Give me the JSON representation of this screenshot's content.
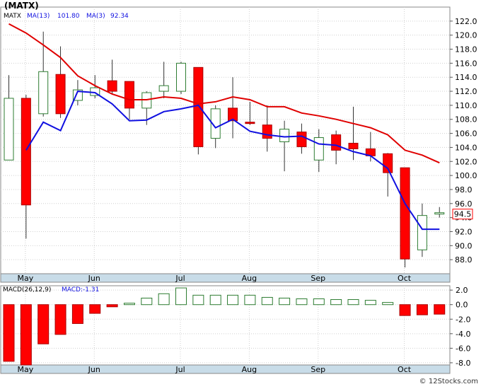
{
  "title": "(MATX)",
  "watermark": "© 12Stocks.com",
  "colors": {
    "up": "#2e7d32",
    "down": "#ff0000",
    "ma13": "#e00000",
    "ma3": "#1010e0",
    "axis_band": "#c8dce8",
    "grid": "#d0d0d0",
    "price_tag_border": "#ff0000"
  },
  "chart_data": [
    {
      "type": "candlestick",
      "legend": {
        "symbol": "MATX",
        "ma13_label": "MA(13)",
        "ma13_value": "101.80",
        "ma3_label": "MA(3)",
        "ma3_value": "92.34"
      },
      "ylim": [
        86,
        124
      ],
      "yticks": [
        88,
        90,
        92,
        94,
        96,
        98,
        100,
        102,
        104,
        106,
        108,
        110,
        112,
        114,
        116,
        118,
        120,
        122
      ],
      "ytick_labels": [
        "88.0",
        "90.0",
        "92.0",
        "94.0",
        "96.0",
        "98.0",
        "100.0",
        "102.0",
        "104.0",
        "106.0",
        "108.0",
        "110.0",
        "112.0",
        "114.0",
        "116.0",
        "118.0",
        "120.0",
        "122.0"
      ],
      "x_labels": [
        {
          "index": 1,
          "label": "May"
        },
        {
          "index": 5,
          "label": "Jun"
        },
        {
          "index": 10,
          "label": "Jul"
        },
        {
          "index": 14,
          "label": "Aug"
        },
        {
          "index": 18,
          "label": "Sep"
        },
        {
          "index": 23,
          "label": "Oct"
        }
      ],
      "last_price_tag": "94.5",
      "last_price": 94.5,
      "candles": [
        {
          "open": 102.2,
          "high": 114.3,
          "low": 102.2,
          "close": 111.0
        },
        {
          "open": 111.0,
          "high": 111.5,
          "low": 91.0,
          "close": 95.8
        },
        {
          "open": 108.8,
          "high": 120.5,
          "low": 108.4,
          "close": 114.8
        },
        {
          "open": 114.4,
          "high": 118.4,
          "low": 108.2,
          "close": 108.8
        },
        {
          "open": 110.7,
          "high": 113.6,
          "low": 110.0,
          "close": 112.2
        },
        {
          "open": 111.4,
          "high": 114.3,
          "low": 111.0,
          "close": 112.5
        },
        {
          "open": 113.5,
          "high": 116.5,
          "low": 111.5,
          "close": 112.0
        },
        {
          "open": 113.4,
          "high": 113.4,
          "low": 108.0,
          "close": 109.6
        },
        {
          "open": 109.6,
          "high": 112.0,
          "low": 107.2,
          "close": 111.8
        },
        {
          "open": 112.0,
          "high": 116.2,
          "low": 111.0,
          "close": 112.8
        },
        {
          "open": 112.0,
          "high": 116.2,
          "low": 111.6,
          "close": 116.0
        },
        {
          "open": 115.4,
          "high": 115.4,
          "low": 103.0,
          "close": 104.1
        },
        {
          "open": 105.3,
          "high": 110.0,
          "low": 103.9,
          "close": 109.5
        },
        {
          "open": 109.6,
          "high": 114.0,
          "low": 105.3,
          "close": 107.8
        },
        {
          "open": 107.6,
          "high": 110.5,
          "low": 107.2,
          "close": 107.4
        },
        {
          "open": 107.2,
          "high": 110.0,
          "low": 103.4,
          "close": 105.3
        },
        {
          "open": 104.8,
          "high": 107.8,
          "low": 100.6,
          "close": 106.6
        },
        {
          "open": 106.2,
          "high": 107.4,
          "low": 103.1,
          "close": 104.1
        },
        {
          "open": 102.2,
          "high": 106.6,
          "low": 100.5,
          "close": 105.4
        },
        {
          "open": 105.8,
          "high": 106.4,
          "low": 101.6,
          "close": 103.6
        },
        {
          "open": 104.6,
          "high": 109.8,
          "low": 102.2,
          "close": 103.8
        },
        {
          "open": 103.8,
          "high": 106.2,
          "low": 102.0,
          "close": 102.8
        },
        {
          "open": 103.1,
          "high": 103.2,
          "low": 97.0,
          "close": 100.4
        },
        {
          "open": 101.1,
          "high": 101.1,
          "low": 86.9,
          "close": 88.1
        },
        {
          "open": 89.4,
          "high": 96.0,
          "low": 88.4,
          "close": 94.3
        },
        {
          "open": 94.5,
          "high": 95.5,
          "low": 94.0,
          "close": 94.7
        }
      ],
      "series": [
        {
          "name": "MA(13)",
          "values": [
            121.6,
            120.3,
            118.6,
            116.8,
            114.2,
            112.8,
            111.6,
            110.8,
            110.8,
            111.2,
            111.0,
            110.2,
            110.5,
            111.2,
            110.8,
            109.8,
            109.8,
            108.9,
            108.5,
            108.0,
            107.4,
            106.8,
            105.8,
            103.6,
            102.9,
            101.8
          ]
        },
        {
          "name": "MA(3)",
          "values": [
            null,
            103.6,
            107.6,
            106.4,
            112.0,
            111.8,
            110.2,
            107.8,
            107.9,
            109.1,
            109.5,
            110.0,
            106.8,
            108.0,
            106.3,
            105.8,
            105.5,
            105.6,
            104.5,
            104.3,
            103.4,
            102.8,
            101.0,
            96.0,
            92.34,
            92.34
          ]
        }
      ]
    },
    {
      "type": "bar",
      "legend": {
        "label": "MACD(26,12,9)",
        "value_label": "MACD:-1.31"
      },
      "ylim": [
        -8.3,
        2.6
      ],
      "yticks": [
        -8,
        -6,
        -4,
        -2,
        0,
        2
      ],
      "ytick_labels": [
        "-8.0",
        "-6.0",
        "-4.0",
        "-2.0",
        "0.0",
        "2.0"
      ],
      "values": [
        -7.8,
        -8.3,
        -5.4,
        -4.1,
        -2.6,
        -1.2,
        -0.3,
        0.2,
        0.9,
        1.5,
        2.3,
        1.3,
        1.3,
        1.3,
        1.3,
        1.0,
        0.9,
        0.8,
        0.8,
        0.7,
        0.7,
        0.6,
        0.3,
        -1.5,
        -1.4,
        -1.31
      ]
    }
  ]
}
